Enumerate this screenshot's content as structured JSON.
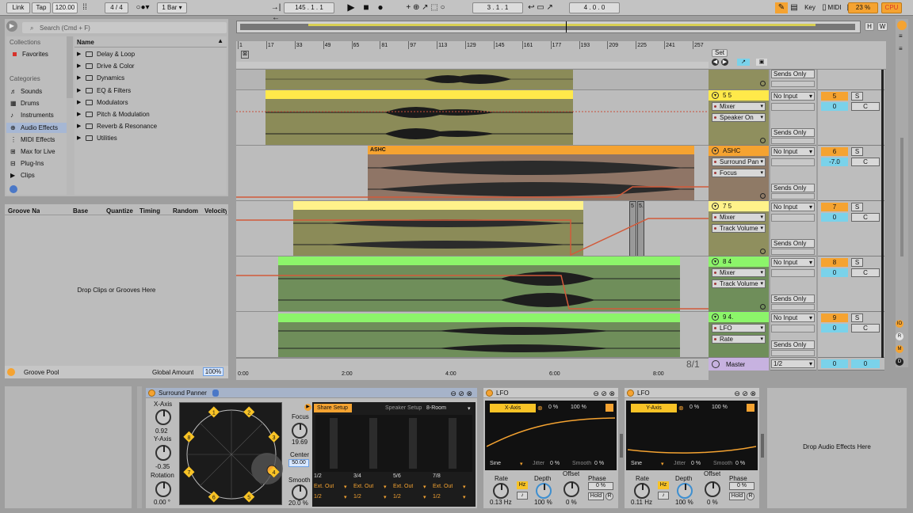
{
  "toolbar": {
    "link": "Link",
    "tap": "Tap",
    "tempo": "120.00",
    "time_sig": "4 / 4",
    "quantize": "1 Bar",
    "position": "145 .  1 .  1",
    "loop_start": "3 .  1 .  1",
    "loop_length": "4 .  0 .  0",
    "key": "Key",
    "midi": "MIDI",
    "cpu_percent": "23 %",
    "cpu": "CPU",
    "h": "H",
    "w": "W"
  },
  "browser": {
    "search_placeholder": "Search (Cmd + F)",
    "collections_title": "Collections",
    "favorites": "Favorites",
    "categories_title": "Categories",
    "categories": [
      "Sounds",
      "Drums",
      "Instruments",
      "Audio Effects",
      "MIDI Effects",
      "Max for Live",
      "Plug-Ins",
      "Clips"
    ],
    "name_header": "Name",
    "folders": [
      "Delay & Loop",
      "Drive & Color",
      "Dynamics",
      "EQ & Filters",
      "Modulators",
      "Pitch & Modulation",
      "Reverb & Resonance",
      "Utilities"
    ]
  },
  "groove": {
    "columns": [
      "Groove Name",
      "Base",
      "Quantize",
      "Timing",
      "Random",
      "Velocity"
    ],
    "drop_text": "Drop Clips or Grooves Here",
    "pool": "Groove Pool",
    "global_amount_label": "Global Amount",
    "global_amount": "100%"
  },
  "arrangement": {
    "bar_numbers": [
      "1",
      "17",
      "33",
      "49",
      "65",
      "81",
      "97",
      "113",
      "129",
      "145",
      "161",
      "177",
      "193",
      "209",
      "225",
      "241",
      "257"
    ],
    "time_labels": [
      "0:00",
      "2:00",
      "4:00",
      "6:00",
      "8:00"
    ],
    "ratio": "8/1",
    "set_label": "Set",
    "clip_ashc": "ASHC",
    "small_clips": [
      "5",
      "5."
    ]
  },
  "tracks": [
    {
      "name": "",
      "dd1": "",
      "dd2": "",
      "input": "Sends Only",
      "number": "",
      "vol": "",
      "pan": ""
    },
    {
      "name": "5 5",
      "dd1": "Mixer",
      "dd2": "Speaker On",
      "input": "No Input",
      "sends": "Sends Only",
      "number": "5",
      "vol": "0",
      "pan": "C"
    },
    {
      "name": "ASHC",
      "dd1": "Surround Pan",
      "dd2": "Focus",
      "input": "No Input",
      "sends": "Sends Only",
      "number": "6",
      "vol": "-7.0",
      "pan": "C"
    },
    {
      "name": "7 5",
      "dd1": "Mixer",
      "dd2": "Track Volume",
      "input": "No Input",
      "sends": "Sends Only",
      "number": "7",
      "vol": "0",
      "pan": "C"
    },
    {
      "name": "8 4",
      "dd1": "Mixer",
      "dd2": "Track Volume",
      "input": "No Input",
      "sends": "Sends Only",
      "number": "8",
      "vol": "0",
      "pan": "C"
    },
    {
      "name": "9 4.",
      "dd1": "LFO",
      "dd2": "Rate",
      "input": "No Input",
      "sends": "Sends Only",
      "number": "9",
      "vol": "0",
      "pan": "C"
    }
  ],
  "master": {
    "name": "Master",
    "output": "1/2",
    "vol": "0",
    "pan": "0"
  },
  "surround_panner": {
    "title": "Surround Panner",
    "x_axis_label": "X-Axis",
    "x_axis_value": "0.92",
    "y_axis_label": "Y-Axis",
    "y_axis_value": "-0.35",
    "rotation_label": "Rotation",
    "rotation_value": "0.00 °",
    "focus_label": "Focus",
    "focus_value": "19.69",
    "center_label": "Center",
    "center_value": "50.00",
    "smooth_label": "Smooth",
    "smooth_value": "20.0 %",
    "share_setup": "Share Setup",
    "speaker_setup_label": "Speaker Setup",
    "speaker_setup_value": "8-Room",
    "speakers": [
      "1",
      "2",
      "3",
      "4",
      "5",
      "6",
      "7",
      "8"
    ],
    "pairs": [
      "1/2",
      "3/4",
      "5/6",
      "7/8"
    ],
    "ext_out": "Ext. Out",
    "out_pairs": [
      "1/2",
      "1/2",
      "1/2",
      "1/2"
    ]
  },
  "lfo1": {
    "title": "LFO",
    "target": "X-Axis",
    "min": "0 %",
    "max": "100 %",
    "shape": "Sine",
    "jitter_label": "Jitter",
    "jitter": "0 %",
    "smooth_label": "Smooth",
    "smooth": "0 %",
    "rate_label": "Rate",
    "rate": "0.13 Hz",
    "hz": "Hz",
    "depth_label": "Depth",
    "depth": "100 %",
    "offset_label": "Offset",
    "offset": "0 %",
    "phase_label": "Phase",
    "phase": "0 %",
    "hold": "Hold",
    "r": "R"
  },
  "lfo2": {
    "title": "LFO",
    "target": "Y-Axis",
    "min": "0 %",
    "max": "100 %",
    "shape": "Sine",
    "jitter_label": "Jitter",
    "jitter": "0 %",
    "smooth_label": "Smooth",
    "smooth": "0 %",
    "rate_label": "Rate",
    "rate": "0.11 Hz",
    "hz": "Hz",
    "depth_label": "Depth",
    "depth": "100 %",
    "offset_label": "Offset",
    "offset": "0 %",
    "phase_label": "Phase",
    "phase": "0 %",
    "hold": "Hold",
    "r": "R"
  },
  "drop_audio": "Drop Audio Effects Here",
  "colors": {
    "accent": "#f5a331",
    "yellow": "#ffe94a",
    "green": "#8cf56a",
    "clip_bg": "#8b8b58",
    "clip_bg_green": "#6c8f5a"
  }
}
